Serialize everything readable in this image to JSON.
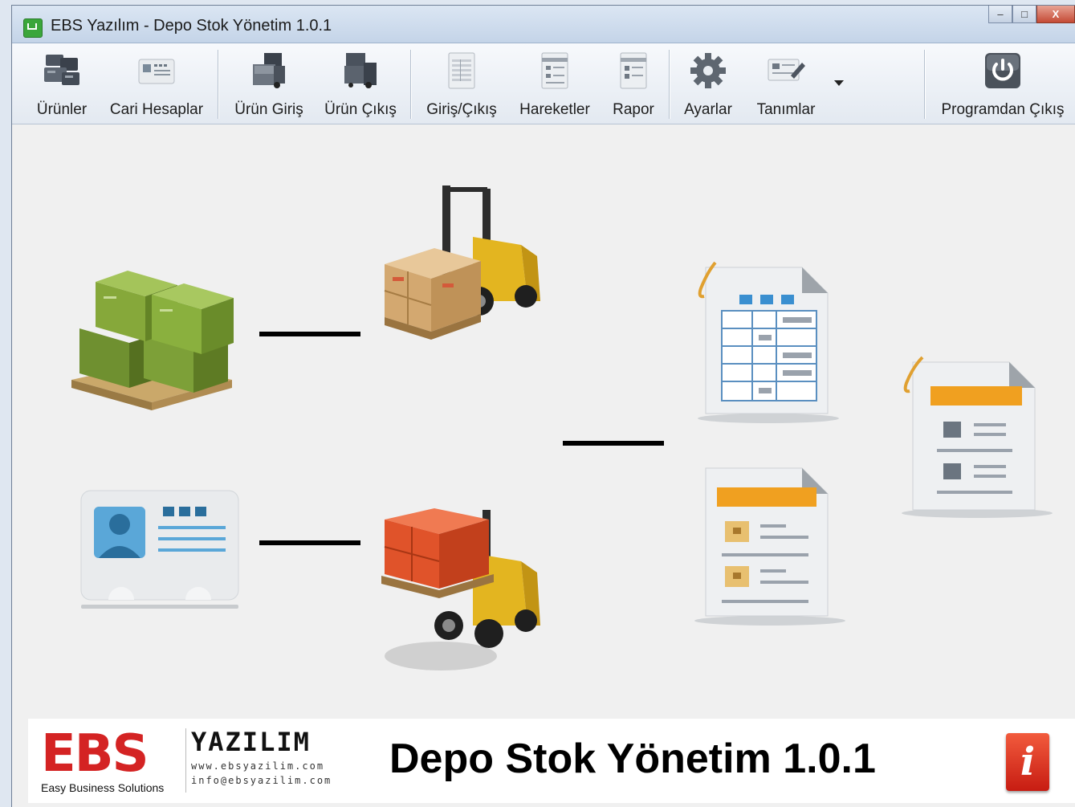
{
  "window": {
    "title": "EBS Yazılım - Depo Stok Yönetim 1.0.1"
  },
  "window_controls": {
    "minimize": "–",
    "maximize": "□",
    "close": "X"
  },
  "toolbar": {
    "items": [
      {
        "label": "Ürünler",
        "icon": "server-boxes-icon"
      },
      {
        "label": "Cari Hesaplar",
        "icon": "id-card-icon"
      },
      {
        "label": "Ürün Giriş",
        "icon": "box-in-icon"
      },
      {
        "label": "Ürün Çıkış",
        "icon": "box-out-icon"
      },
      {
        "label": "Giriş/Çıkış",
        "icon": "sheet-icon"
      },
      {
        "label": "Hareketler",
        "icon": "document-list-icon"
      },
      {
        "label": "Rapor",
        "icon": "report-icon"
      },
      {
        "label": "Ayarlar",
        "icon": "gear-icon"
      },
      {
        "label": "Tanımlar",
        "icon": "definition-edit-icon"
      },
      {
        "label": "Programdan Çıkış",
        "icon": "power-icon"
      }
    ]
  },
  "footer": {
    "brand_letters": "EBS",
    "brand_sub": "Easy Business Solutions",
    "company": "YAZILIM",
    "website": "www.ebsyazilim.com",
    "email": "info@ebsyazilim.com",
    "product_title": "Depo Stok Yönetim 1.0.1",
    "info_glyph": "i"
  },
  "colors": {
    "green_box": "#86a83a",
    "orange_box": "#e0532a",
    "forklift_yellow": "#e3b520",
    "brand_red": "#d42323",
    "doc_header_orange": "#f0a020",
    "table_blue": "#3a8fd0"
  }
}
